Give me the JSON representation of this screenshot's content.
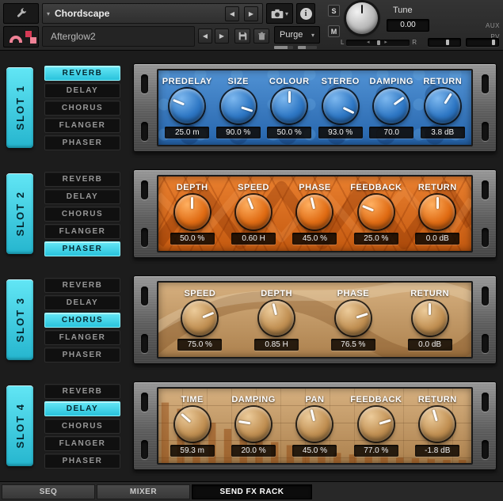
{
  "header": {
    "instrument_name": "Chordscape",
    "patch_name": "Afterglow2",
    "purge_label": "Purge",
    "tune": {
      "label": "Tune",
      "value": "0.00"
    },
    "aux_label": "AUX",
    "pv_label": "PV",
    "solo_label": "S",
    "mute_label": "M",
    "meter_left_label": "L",
    "meter_right_label": "R",
    "icons": {
      "prev": "◀",
      "next": "▶",
      "dropdown": "▾",
      "collapse": "▾",
      "info": "i"
    }
  },
  "slots": [
    {
      "label": "SLOT 1",
      "selected": "REVERB",
      "effects": [
        "REVERB",
        "DELAY",
        "CHORUS",
        "FLANGER",
        "PHASER"
      ],
      "theme": "blue",
      "knobs": [
        {
          "label": "PREDELAY",
          "value": "25.0 m",
          "frac": 0.25
        },
        {
          "label": "SIZE",
          "value": "90.0 %",
          "frac": 0.9
        },
        {
          "label": "COLOUR",
          "value": "50.0 %",
          "frac": 0.5
        },
        {
          "label": "STEREO",
          "value": "93.0 %",
          "frac": 0.93
        },
        {
          "label": "DAMPING",
          "value": "70.0",
          "frac": 0.7
        },
        {
          "label": "RETURN",
          "value": "3.8 dB",
          "frac": 0.62
        }
      ]
    },
    {
      "label": "SLOT 2",
      "selected": "PHASER",
      "effects": [
        "REVERB",
        "DELAY",
        "CHORUS",
        "FLANGER",
        "PHASER"
      ],
      "theme": "orange",
      "knobs": [
        {
          "label": "DEPTH",
          "value": "50.0 %",
          "frac": 0.5
        },
        {
          "label": "SPEED",
          "value": "0.60 H",
          "frac": 0.42
        },
        {
          "label": "PHASE",
          "value": "45.0 %",
          "frac": 0.45
        },
        {
          "label": "FEEDBACK",
          "value": "25.0 %",
          "frac": 0.25
        },
        {
          "label": "RETURN",
          "value": "0.0 dB",
          "frac": 0.5
        }
      ]
    },
    {
      "label": "SLOT 3",
      "selected": "CHORUS",
      "effects": [
        "REVERB",
        "DELAY",
        "CHORUS",
        "FLANGER",
        "PHASER"
      ],
      "theme": "tan-chorus",
      "knobs": [
        {
          "label": "SPEED",
          "value": "75.0 %",
          "frac": 0.75
        },
        {
          "label": "DEPTH",
          "value": "0.85 H",
          "frac": 0.45
        },
        {
          "label": "PHASE",
          "value": "76.5 %",
          "frac": 0.765
        },
        {
          "label": "RETURN",
          "value": "0.0 dB",
          "frac": 0.5
        }
      ]
    },
    {
      "label": "SLOT 4",
      "selected": "DELAY",
      "effects": [
        "REVERB",
        "DELAY",
        "CHORUS",
        "FLANGER",
        "PHASER"
      ],
      "theme": "tan-delay",
      "knobs": [
        {
          "label": "TIME",
          "value": "59.3 m",
          "frac": 0.32
        },
        {
          "label": "DAMPING",
          "value": "20.0 %",
          "frac": 0.2
        },
        {
          "label": "PAN",
          "value": "45.0 %",
          "frac": 0.45
        },
        {
          "label": "FEEDBACK",
          "value": "77.0 %",
          "frac": 0.77
        },
        {
          "label": "RETURN",
          "value": "-1.8 dB",
          "frac": 0.44
        }
      ]
    }
  ],
  "footer": {
    "tabs": [
      "SEQ",
      "MIXER",
      "SEND FX RACK"
    ],
    "selected_tab": "SEND FX RACK"
  },
  "colors": {
    "accent_cyan": "#3fd2e9",
    "panel_blue": "#2f7dcc",
    "panel_orange": "#e26a14",
    "panel_tan": "#c89a63"
  }
}
